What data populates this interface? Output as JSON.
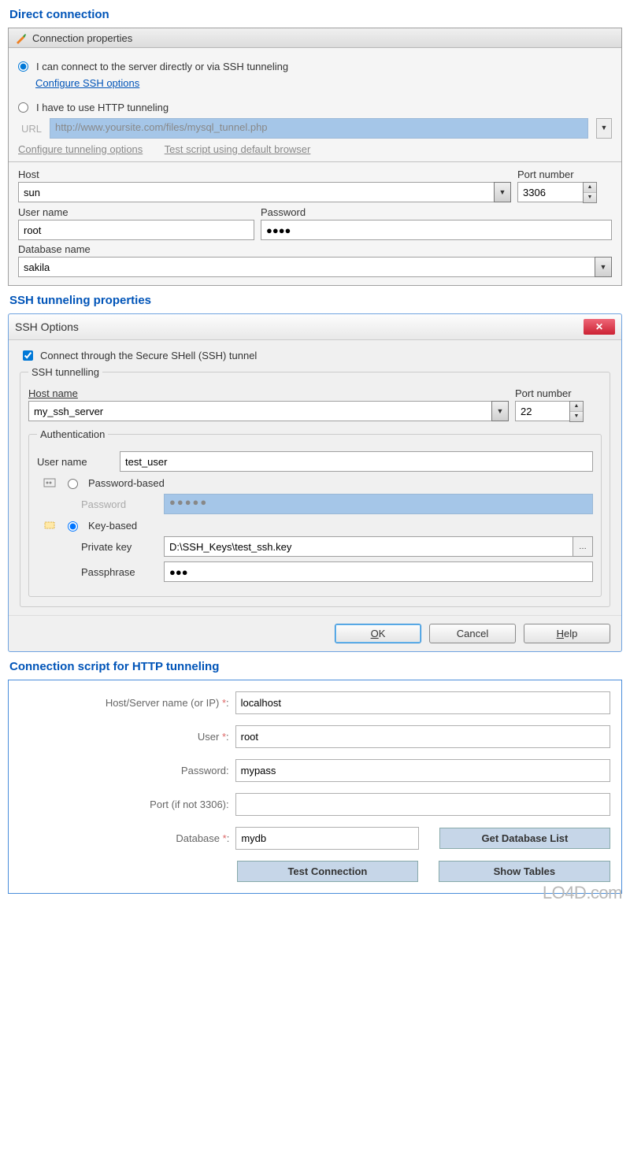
{
  "sections": {
    "direct": "Direct connection",
    "ssh": "SSH tunneling properties",
    "http": "Connection script for HTTP tunneling"
  },
  "conn": {
    "header": "Connection properties",
    "radio_direct": "I can connect to the server directly or via SSH tunneling",
    "configure_ssh": "Configure SSH options",
    "radio_http": "I have to use HTTP tunneling",
    "url_label": "URL",
    "url_value": "http://www.yoursite.com/files/mysql_tunnel.php",
    "configure_tunnel": "Configure tunneling options",
    "test_script": "Test script using default browser",
    "host_label": "Host",
    "host_value": "sun",
    "port_label": "Port number",
    "port_value": "3306",
    "user_label": "User name",
    "user_value": "root",
    "pass_label": "Password",
    "pass_value": "●●●●",
    "db_label": "Database name",
    "db_value": "sakila"
  },
  "sshdlg": {
    "title": "SSH Options",
    "chk": "Connect through the Secure SHell (SSH) tunnel",
    "fs_title": "SSH tunnelling",
    "host_label": "Host name",
    "host_value": "my_ssh_server",
    "port_label": "Port number",
    "port_value": "22",
    "auth_title": "Authentication",
    "user_label": "User name",
    "user_value": "test_user",
    "pw_based": "Password-based",
    "pw_label": "Password",
    "pw_value": "●●●●●",
    "key_based": "Key-based",
    "pk_label": "Private key",
    "pk_value": "D:\\SSH_Keys\\test_ssh.key",
    "pp_label": "Passphrase",
    "pp_value": "●●●",
    "ok": "OK",
    "cancel": "Cancel",
    "help": "Help"
  },
  "httpform": {
    "host_label": "Host/Server name (or IP)",
    "host_value": "localhost",
    "user_label": "User",
    "user_value": "root",
    "pass_label": "Password:",
    "pass_value": "mypass",
    "port_label": "Port (if not 3306):",
    "port_value": "",
    "db_label": "Database",
    "db_value": "mydb",
    "get_db": "Get Database List",
    "test": "Test Connection",
    "show": "Show Tables"
  },
  "watermark": "LO4D.com"
}
